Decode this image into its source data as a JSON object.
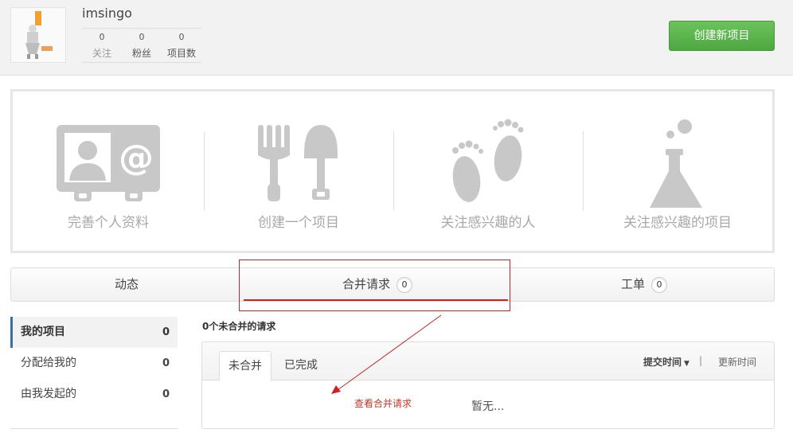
{
  "user": {
    "name": "imsingo",
    "stats": [
      {
        "count": "0",
        "label": "关注"
      },
      {
        "count": "0",
        "label": "粉丝"
      },
      {
        "count": "0",
        "label": "项目数"
      }
    ]
  },
  "header": {
    "create_label": "创建新项目"
  },
  "quick_actions": [
    {
      "label": "完善个人资料",
      "icon": "profile-card-icon"
    },
    {
      "label": "创建一个项目",
      "icon": "fork-shovel-icon"
    },
    {
      "label": "关注感兴趣的人",
      "icon": "footprints-icon"
    },
    {
      "label": "关注感兴趣的项目",
      "icon": "flask-icon"
    }
  ],
  "tabs": [
    {
      "label": "动态"
    },
    {
      "label": "合并请求",
      "count": "0"
    },
    {
      "label": "工单",
      "count": "0"
    }
  ],
  "sidebar": {
    "items": [
      {
        "label": "我的项目",
        "count": "0"
      },
      {
        "label": "分配给我的",
        "count": "0"
      },
      {
        "label": "由我发起的",
        "count": "0"
      }
    ]
  },
  "merge_requests": {
    "summary": "0个未合并的请求",
    "tabs": [
      "未合并",
      "已完成"
    ],
    "sort_submit": "提交时间",
    "sort_separator": "|",
    "sort_update": "更新时间",
    "annotation": "查看合并请求",
    "empty": "暂无..."
  },
  "colors": {
    "accent_green": "#5cb54d",
    "highlight_red": "#cc2222",
    "active_blue": "#3b6ea8",
    "icon_gray": "#c8c8c8"
  }
}
